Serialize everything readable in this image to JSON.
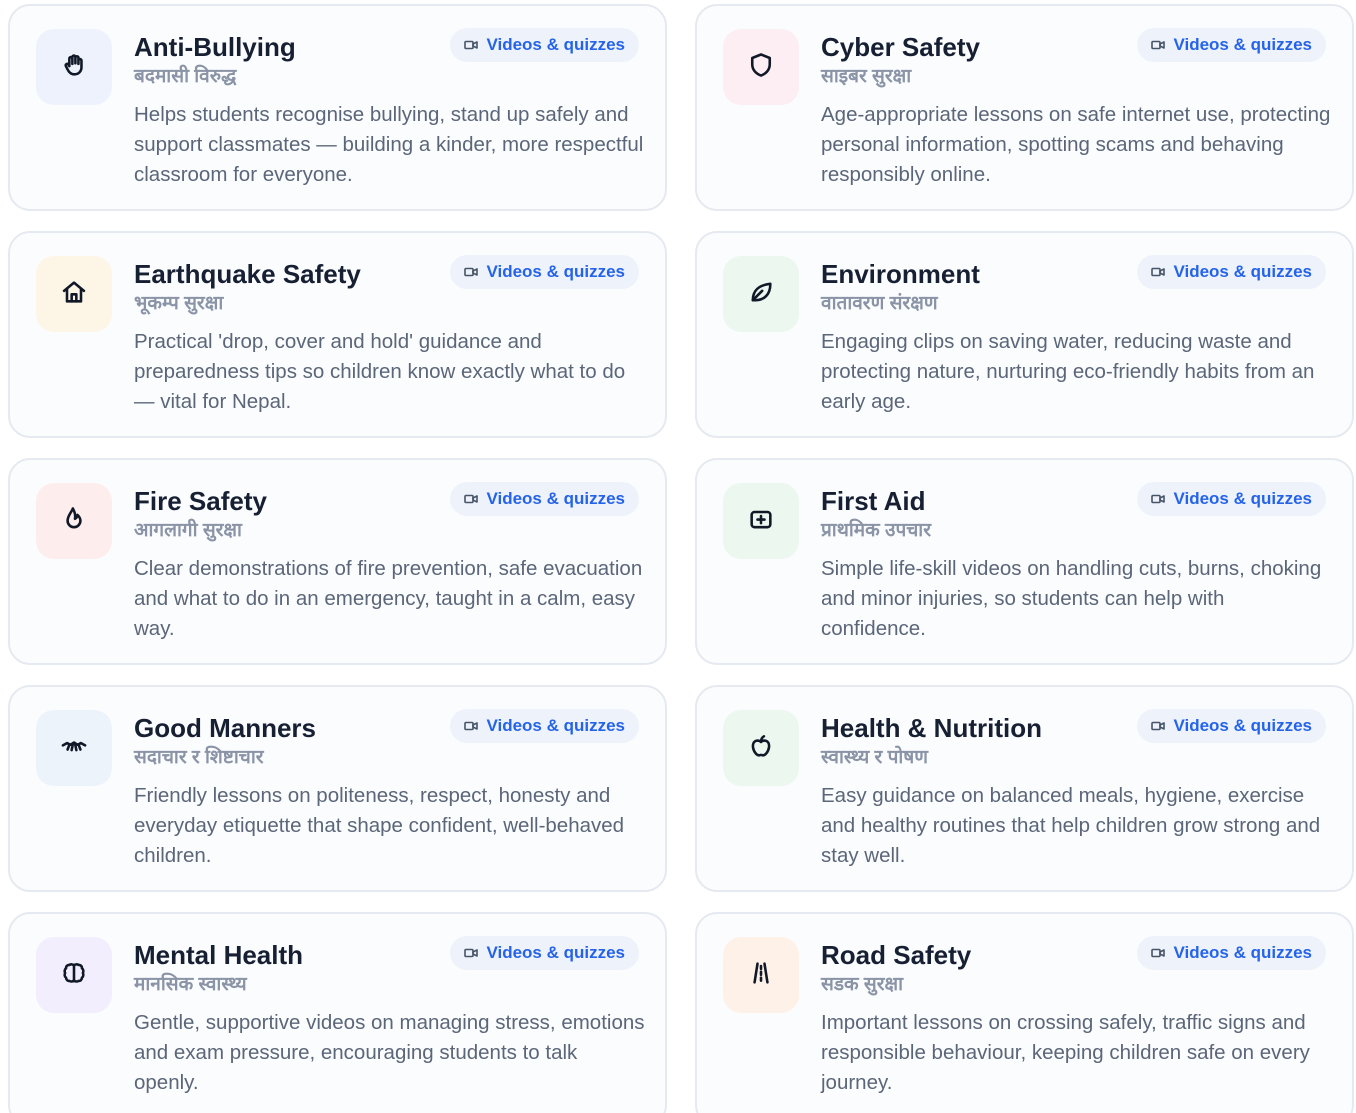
{
  "badge_label": "Videos & quizzes",
  "badge_icon": "video-camera-icon",
  "topics": [
    {
      "title": "Anti-Bullying",
      "subtitle": "बदमासी विरुद्ध",
      "description": "Helps students recognise bullying, stand up safely and support classmates — building a kinder, more respectful classroom for everyone.",
      "icon": "raised-hand-icon",
      "tile_color": "#eef2fd"
    },
    {
      "title": "Cyber Safety",
      "subtitle": "साइबर सुरक्षा",
      "description": "Age-appropriate lessons on safe internet use, protecting personal information, spotting scams and behaving responsibly online.",
      "icon": "shield-icon",
      "tile_color": "#fdeef3"
    },
    {
      "title": "Earthquake Safety",
      "subtitle": "भूकम्प सुरक्षा",
      "description": "Practical 'drop, cover and hold' guidance and preparedness tips so children know exactly what to do — vital for Nepal.",
      "icon": "house-icon",
      "tile_color": "#fdf5e6"
    },
    {
      "title": "Environment",
      "subtitle": "वातावरण संरक्षण",
      "description": "Engaging clips on saving water, reducing waste and protecting nature, nurturing eco-friendly habits from an early age.",
      "icon": "leaf-icon",
      "tile_color": "#ebf7ef"
    },
    {
      "title": "Fire Safety",
      "subtitle": "आगलागी सुरक्षा",
      "description": "Clear demonstrations of fire prevention, safe evacuation and what to do in an emergency, taught in a calm, easy way.",
      "icon": "flame-icon",
      "tile_color": "#fdeeed"
    },
    {
      "title": "First Aid",
      "subtitle": "प्राथमिक उपचार",
      "description": "Simple life-skill videos on handling cuts, burns, choking and minor injuries, so students can help with confidence.",
      "icon": "first-aid-kit-icon",
      "tile_color": "#ebf7ef"
    },
    {
      "title": "Good Manners",
      "subtitle": "सदाचार र शिष्टाचार",
      "description": "Friendly lessons on politeness, respect, honesty and everyday etiquette that shape confident, well-behaved children.",
      "icon": "handshake-icon",
      "tile_color": "#edf3fb"
    },
    {
      "title": "Health & Nutrition",
      "subtitle": "स्वास्थ्य र पोषण",
      "description": "Easy guidance on balanced meals, hygiene, exercise and healthy routines that help children grow strong and stay well.",
      "icon": "apple-icon",
      "tile_color": "#ebf7ef"
    },
    {
      "title": "Mental Health",
      "subtitle": "मानसिक स्वास्थ्य",
      "description": "Gentle, supportive videos on managing stress, emotions and exam pressure, encouraging students to talk openly.",
      "icon": "brain-icon",
      "tile_color": "#f2eefd"
    },
    {
      "title": "Road Safety",
      "subtitle": "सडक सुरक्षा",
      "description": "Important lessons on crossing safely, traffic signs and responsible behaviour, keeping children safe on every journey.",
      "icon": "road-icon",
      "tile_color": "#fdf1e8"
    }
  ]
}
